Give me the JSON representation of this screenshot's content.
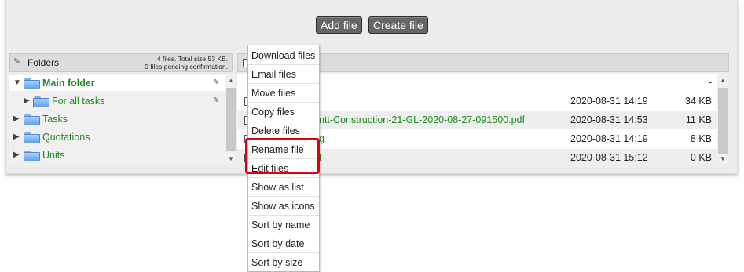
{
  "toolbar": {
    "add_file_label": "Add file",
    "create_file_label": "Create file"
  },
  "folders_panel": {
    "header_title": "Folders",
    "stats_line1": "4 files. Total size 53 KB.",
    "stats_line2": "0 files pending confirmation.",
    "items": [
      {
        "label": "Main folder",
        "expanded": true,
        "selected": true,
        "editable": true
      },
      {
        "label": "For all tasks",
        "expanded": false,
        "selected": false,
        "editable": true
      },
      {
        "label": "Tasks",
        "expanded": false,
        "selected": false,
        "editable": false
      },
      {
        "label": "Quotations",
        "expanded": false,
        "selected": false,
        "editable": false
      },
      {
        "label": "Units",
        "expanded": false,
        "selected": false,
        "editable": false
      }
    ]
  },
  "files_panel": {
    "parent_row_dash": "-",
    "rows": [
      {
        "name": "",
        "date": "2020-08-31 14:19",
        "size": "34 KB"
      },
      {
        "name": "ntt-Construction-21-GL-2020-08-27-091500.pdf",
        "date": "2020-08-31 14:53",
        "size": "11 KB"
      },
      {
        "name": "g",
        "date": "2020-08-31 14:19",
        "size": "8 KB"
      },
      {
        "name": "t",
        "date": "2020-08-31 15:12",
        "size": "0 KB"
      }
    ]
  },
  "context_menu": {
    "items": [
      "Download files",
      "Email files",
      "Move files",
      "Copy files",
      "Delete files",
      "Rename file",
      "Edit files",
      "Show as list",
      "Show as icons",
      "Sort by name",
      "Sort by date",
      "Sort by size"
    ]
  },
  "colors": {
    "folder_label": "#1e8a1e",
    "button_bg": "#666666",
    "highlight": "#e0000f",
    "panel_bg": "#ececec"
  },
  "icons": {
    "pencil": "pencil-icon",
    "folder": "folder-icon",
    "expand": "triangle-right-icon",
    "collapse": "triangle-down-icon",
    "scroll_up": "scroll-up-arrow-icon",
    "scroll_down": "scroll-down-arrow-icon",
    "file": "file-icon"
  }
}
